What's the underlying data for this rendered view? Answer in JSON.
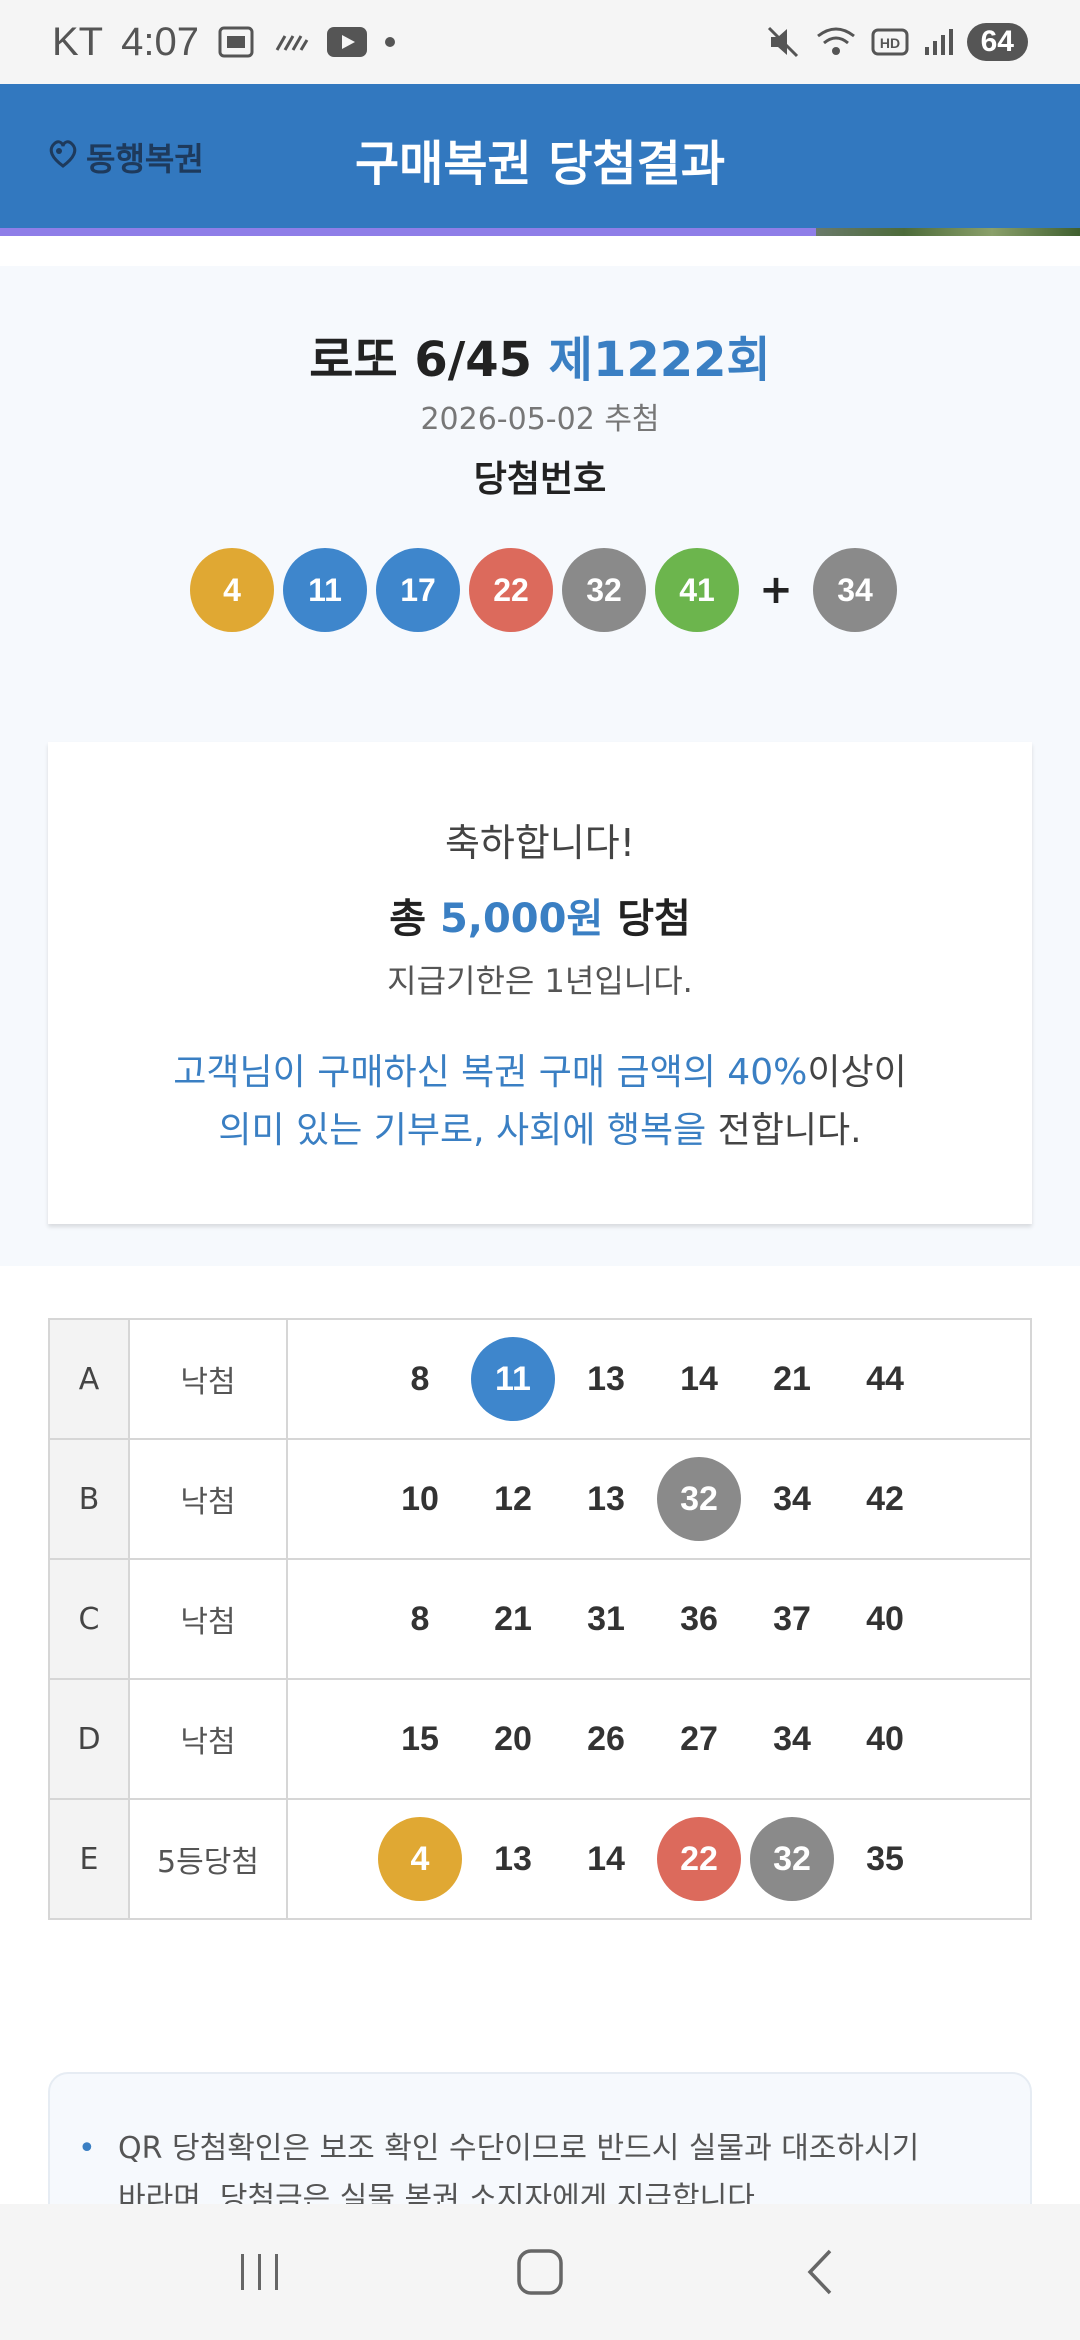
{
  "status_bar": {
    "carrier": "KT",
    "time": "4:07",
    "battery": "64",
    "icons": [
      "gallery-icon",
      "signal-bars-icon",
      "youtube-icon",
      "notification-dot-icon",
      "mute-icon",
      "wifi-icon",
      "hd-icon",
      "cell-signal-icon"
    ]
  },
  "header": {
    "logo_text": "동행복권",
    "title": "구매복권 당첨결과"
  },
  "draw": {
    "game": "로또 6/45",
    "round": "제1222회",
    "date": "2026-05-02 추첨",
    "label": "당첨번호",
    "numbers": [
      "4",
      "11",
      "17",
      "22",
      "32",
      "41"
    ],
    "plus": "+",
    "bonus": "34",
    "colors": {
      "yellow": "#e0a833",
      "blue": "#3e86cc",
      "red": "#dc6a5c",
      "gray": "#8a8a8a",
      "green": "#6cb54d"
    }
  },
  "prize": {
    "congrats": "축하합니다!",
    "total_prefix": "총 ",
    "total_amount": "5,000원",
    "total_suffix": " 당첨",
    "deadline": "지급기한은 1년입니다.",
    "donate_line1_accent": "고객님이 구매하신 복권 구매 금액의 40%",
    "donate_line1_rest": "이상이",
    "donate_line2_accent": "의미 있는 기부로, 사회에 행복을",
    "donate_line2_rest": " 전합니다."
  },
  "games": [
    {
      "letter": "A",
      "result": "낙첨",
      "numbers": [
        "8",
        "11",
        "13",
        "14",
        "21",
        "44"
      ],
      "hits": [
        "",
        "blue",
        "",
        "",
        "",
        ""
      ]
    },
    {
      "letter": "B",
      "result": "낙첨",
      "numbers": [
        "10",
        "12",
        "13",
        "32",
        "34",
        "42"
      ],
      "hits": [
        "",
        "",
        "",
        "gray",
        "",
        ""
      ]
    },
    {
      "letter": "C",
      "result": "낙첨",
      "numbers": [
        "8",
        "21",
        "31",
        "36",
        "37",
        "40"
      ],
      "hits": [
        "",
        "",
        "",
        "",
        "",
        ""
      ]
    },
    {
      "letter": "D",
      "result": "낙첨",
      "numbers": [
        "15",
        "20",
        "26",
        "27",
        "34",
        "40"
      ],
      "hits": [
        "",
        "",
        "",
        "",
        "",
        ""
      ]
    },
    {
      "letter": "E",
      "result": "5등당첨",
      "numbers": [
        "4",
        "13",
        "14",
        "22",
        "32",
        "35"
      ],
      "hits": [
        "yellow",
        "",
        "",
        "red",
        "gray",
        ""
      ]
    }
  ],
  "notice": {
    "line1": "QR 당첨확인은 보조 확인 수단이므로 반드시 실물과 대조하시기",
    "line2": "바라며, 당첨금은 실물 복권 소지자에게 지급합니다."
  },
  "nav": {
    "buttons": [
      "recent-apps-icon",
      "home-icon",
      "back-icon"
    ]
  }
}
